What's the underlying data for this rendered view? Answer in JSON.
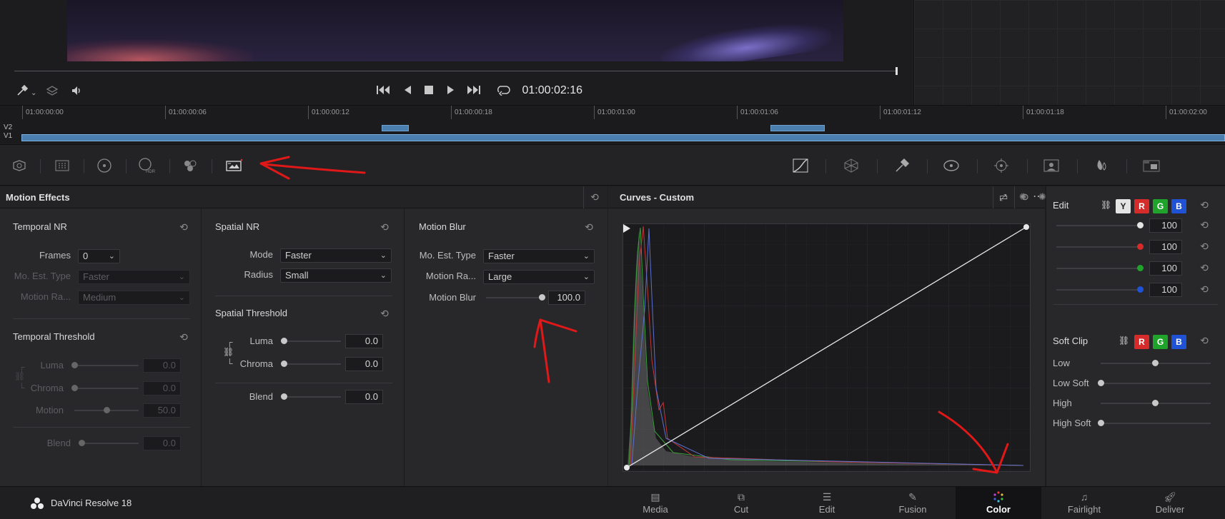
{
  "viewer": {
    "timecode": "01:00:02:16"
  },
  "timeline": {
    "ticks": [
      "01:00:00:00",
      "01:00:00:06",
      "01:00:00:12",
      "01:00:00:18",
      "01:00:01:00",
      "01:00:01:06",
      "01:00:01:12",
      "01:00:01:18",
      "01:00:02:00"
    ],
    "tracks": [
      "V2",
      "V1"
    ]
  },
  "motion_effects": {
    "title": "Motion Effects",
    "temporal_nr": {
      "title": "Temporal NR",
      "frames_label": "Frames",
      "frames_value": "0",
      "mo_est_label": "Mo. Est. Type",
      "mo_est_value": "Faster",
      "motion_range_label": "Motion Ra...",
      "motion_range_value": "Medium"
    },
    "temporal_threshold": {
      "title": "Temporal Threshold",
      "luma_label": "Luma",
      "luma_value": "0.0",
      "chroma_label": "Chroma",
      "chroma_value": "0.0",
      "motion_label": "Motion",
      "motion_value": "50.0",
      "blend_label": "Blend",
      "blend_value": "0.0"
    },
    "spatial_nr": {
      "title": "Spatial NR",
      "mode_label": "Mode",
      "mode_value": "Faster",
      "radius_label": "Radius",
      "radius_value": "Small"
    },
    "spatial_threshold": {
      "title": "Spatial Threshold",
      "luma_label": "Luma",
      "luma_value": "0.0",
      "chroma_label": "Chroma",
      "chroma_value": "0.0",
      "blend_label": "Blend",
      "blend_value": "0.0"
    },
    "motion_blur": {
      "title": "Motion Blur",
      "mo_est_label": "Mo. Est. Type",
      "mo_est_value": "Faster",
      "motion_range_label": "Motion Ra...",
      "motion_range_value": "Large",
      "motion_blur_label": "Motion Blur",
      "motion_blur_value": "100.0"
    }
  },
  "curves": {
    "title": "Curves - Custom"
  },
  "edit_panel": {
    "edit_label": "Edit",
    "channels": [
      "Y",
      "R",
      "G",
      "B"
    ],
    "values": [
      "100",
      "100",
      "100",
      "100"
    ],
    "soft_clip_label": "Soft Clip",
    "soft_clip_channels": [
      "R",
      "G",
      "B"
    ],
    "low_label": "Low",
    "low_soft_label": "Low Soft",
    "high_label": "High",
    "high_soft_label": "High Soft"
  },
  "app": {
    "name": "DaVinci Resolve 18"
  },
  "pages": [
    {
      "label": "Media",
      "icon": "media-icon"
    },
    {
      "label": "Cut",
      "icon": "cut-icon"
    },
    {
      "label": "Edit",
      "icon": "edit-icon"
    },
    {
      "label": "Fusion",
      "icon": "fusion-icon"
    },
    {
      "label": "Color",
      "icon": "color-icon"
    },
    {
      "label": "Fairlight",
      "icon": "fairlight-icon"
    },
    {
      "label": "Deliver",
      "icon": "deliver-icon"
    }
  ],
  "active_page": "Color",
  "colors": {
    "accent_blue": "#4b7fb0",
    "red_chip": "#d62b2b",
    "green_chip": "#1fa32a",
    "blue_chip": "#2052d6",
    "annotation_red": "#e01818"
  }
}
